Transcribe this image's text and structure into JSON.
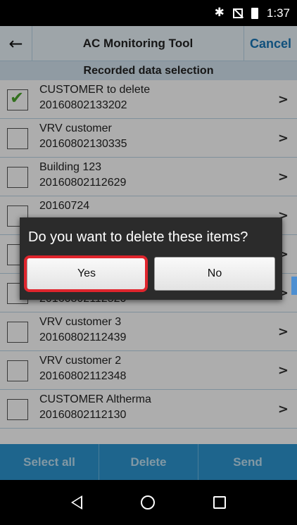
{
  "status_bar": {
    "bluetooth_icon": "bluetooth-icon",
    "no_sim_icon": "no-sim-icon",
    "battery_icon": "battery-icon",
    "time": "1:37"
  },
  "header": {
    "back_icon": "back-arrow-icon",
    "title": "AC Monitoring Tool",
    "cancel_label": "Cancel"
  },
  "section_title": "Recorded data selection",
  "items": [
    {
      "name": "CUSTOMER to delete",
      "date": "20160802133202",
      "checked": true
    },
    {
      "name": "VRV customer",
      "date": "20160802130335",
      "checked": false
    },
    {
      "name": "Building 123",
      "date": "20160802112629",
      "checked": false
    },
    {
      "name": "20160724",
      "date": "",
      "checked": false
    },
    {
      "name": "",
      "date": "",
      "checked": false
    },
    {
      "name": "",
      "date": "20160802112520",
      "checked": false
    },
    {
      "name": "VRV customer 3",
      "date": "20160802112439",
      "checked": false
    },
    {
      "name": "VRV customer 2",
      "date": "20160802112348",
      "checked": false
    },
    {
      "name": "CUSTOMER Altherma",
      "date": "20160802112130",
      "checked": false
    }
  ],
  "bottom_bar": {
    "select_all": "Select all",
    "delete": "Delete",
    "send": "Send"
  },
  "dialog": {
    "message": "Do you want to delete these items?",
    "yes": "Yes",
    "no": "No"
  },
  "colors": {
    "accent": "#2d95d0",
    "highlight": "#e0252d",
    "check": "#4aa62b"
  }
}
